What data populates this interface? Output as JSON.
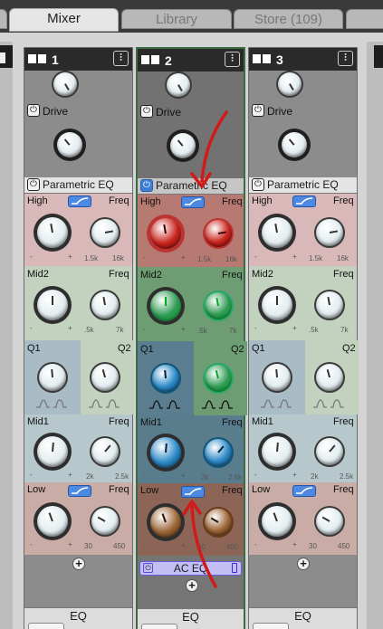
{
  "tabs": [
    {
      "label": "",
      "active": false
    },
    {
      "label": "Mixer",
      "active": true
    },
    {
      "label": "Library",
      "active": false
    },
    {
      "label": "Store (109)",
      "active": false
    },
    {
      "label": "",
      "active": false
    }
  ],
  "strips": [
    {
      "number": "1",
      "drive_label": "Drive",
      "eq_label": "Parametric EQ",
      "high": "High",
      "freq": "Freq",
      "mid2": "Mid2",
      "mid1": "Mid1",
      "q1": "Q1",
      "q2": "Q2",
      "low": "Low",
      "high_freq_min": "1.5k",
      "high_freq_max": "16k",
      "mid2_min": ".5k",
      "mid2_max": "7k",
      "mid1_min": "2k",
      "mid1_max": "2.5k",
      "low_min": "30",
      "low_max": "450",
      "footer": "EQ"
    },
    {
      "number": "2",
      "drive_label": "Drive",
      "eq_label": "Parametric EQ",
      "high": "High",
      "freq": "Freq",
      "mid2": "Mid2",
      "mid1": "Mid1",
      "q1": "Q1",
      "q2": "Q2",
      "low": "Low",
      "high_freq_min": "1.5k",
      "high_freq_max": "16k",
      "mid2_min": ".5k",
      "mid2_max": "7k",
      "mid1_min": ".2k",
      "mid1_max": "2.5k",
      "low_min": "30",
      "low_max": "450",
      "footer": "EQ",
      "plugin": "AC EQ"
    },
    {
      "number": "3",
      "drive_label": "Drive",
      "eq_label": "Parametric EQ",
      "high": "High",
      "freq": "Freq",
      "mid2": "Mid2",
      "mid1": "Mid1",
      "q1": "Q1",
      "q2": "Q2",
      "low": "Low",
      "high_freq_min": "1.5k",
      "high_freq_max": "16k",
      "mid2_min": ".5k",
      "mid2_max": "7k",
      "mid1_min": "2k",
      "mid1_max": "2.5k",
      "low_min": "30",
      "low_max": "450",
      "footer": "EQ"
    }
  ],
  "scale": {
    "minus": "-",
    "plus": "+"
  },
  "colors": {
    "high_band": "#d8b8b8",
    "mid2_band": "#c3d2bf",
    "q_band": "#a9bcc6",
    "mid1_band": "#b7c8cd",
    "low_band": "#c9aca5",
    "selected_strip": "#3c6a45",
    "annotation_arrow": "#d11a1a"
  },
  "icons": {
    "power": "power-icon",
    "mixer": "sliders-icon",
    "shape": "shelf-filter-icon",
    "add": "plus-icon"
  }
}
